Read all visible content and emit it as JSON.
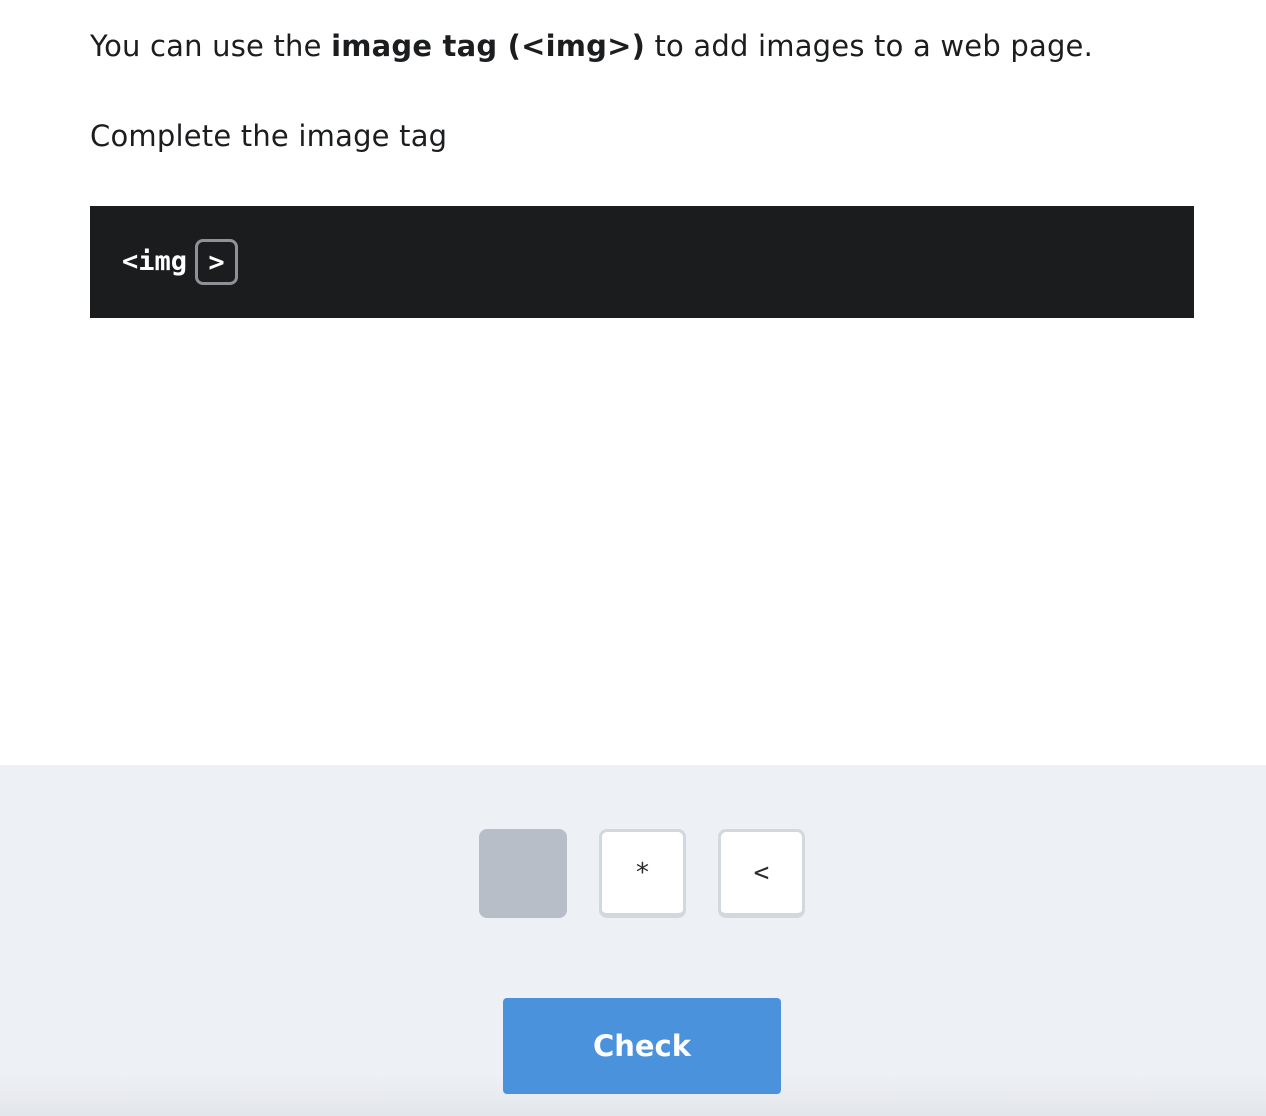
{
  "lesson": {
    "intro_before": "You can use the ",
    "intro_bold": "image tag (<img>)",
    "intro_after": " to add images to a web page.",
    "instruction": "Complete the image tag"
  },
  "code": {
    "prefix": "<img",
    "slot_value": ">"
  },
  "tiles": [
    {
      "label": "",
      "state": "used"
    },
    {
      "label": "*",
      "state": "available"
    },
    {
      "label": "<",
      "state": "available"
    }
  ],
  "actions": {
    "check_label": "Check"
  },
  "colors": {
    "code_background": "#1b1c1e",
    "tray_background": "#edf0f5",
    "check_button": "#4a92db",
    "used_tile": "#b8bec8"
  }
}
